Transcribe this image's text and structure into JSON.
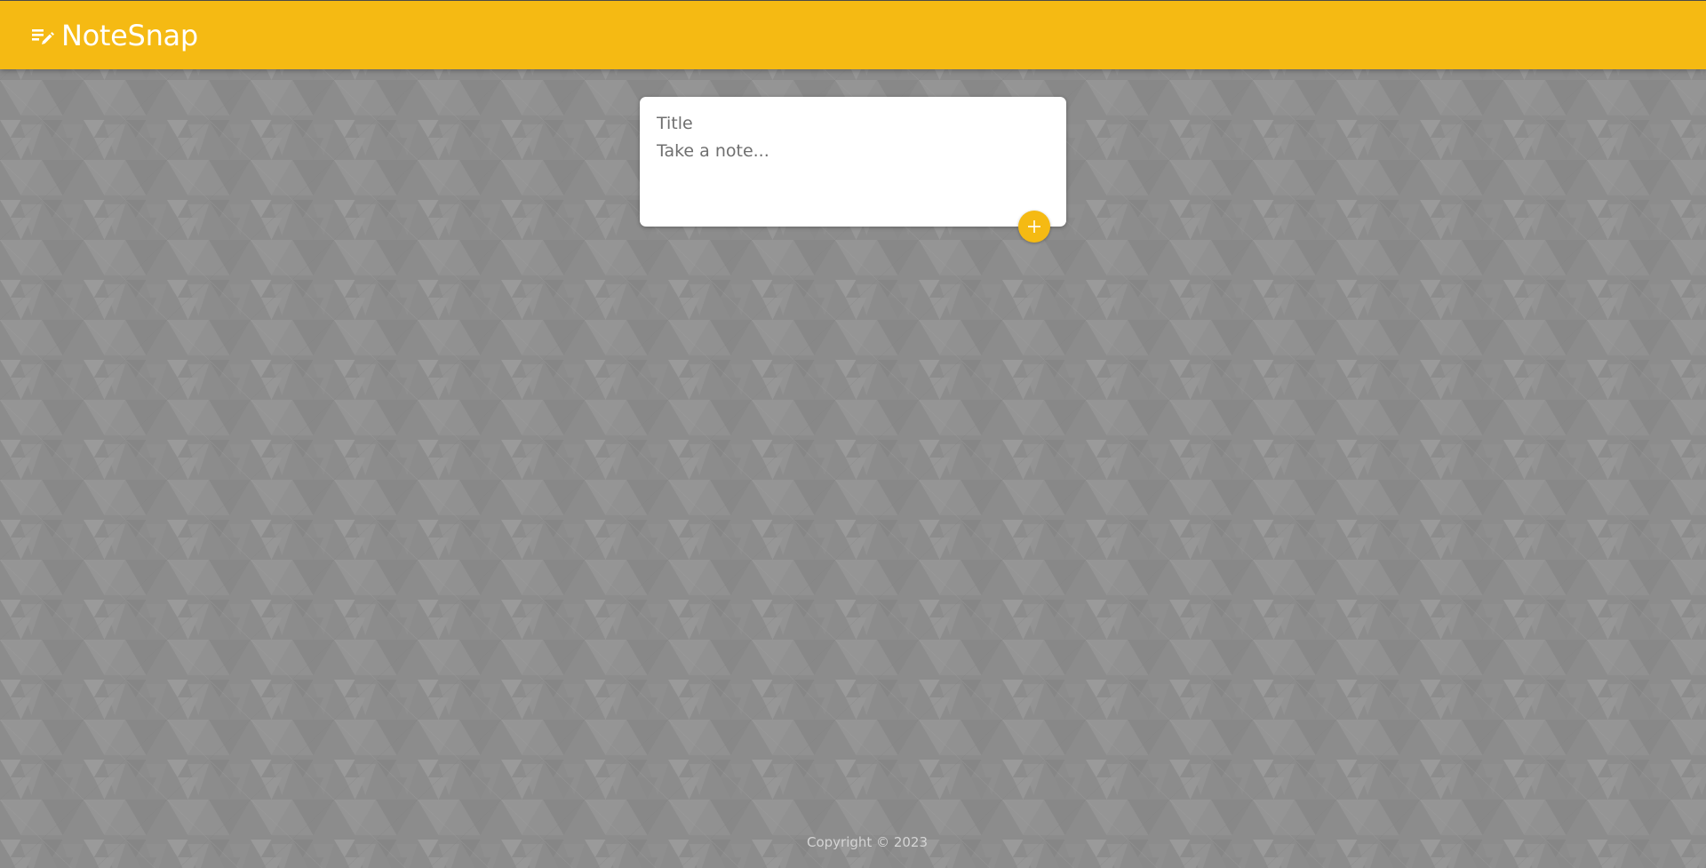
{
  "header": {
    "title": "NoteSnap",
    "icon": "edit-note-icon",
    "bg_color": "#f5ba13"
  },
  "note_form": {
    "title_placeholder": "Title",
    "content_placeholder": "Take a note...",
    "add_icon": "plus-icon"
  },
  "footer": {
    "copyright": "Copyright © 2023"
  },
  "colors": {
    "accent": "#f5ba13",
    "background": "#8c8c8c",
    "card": "#ffffff"
  }
}
